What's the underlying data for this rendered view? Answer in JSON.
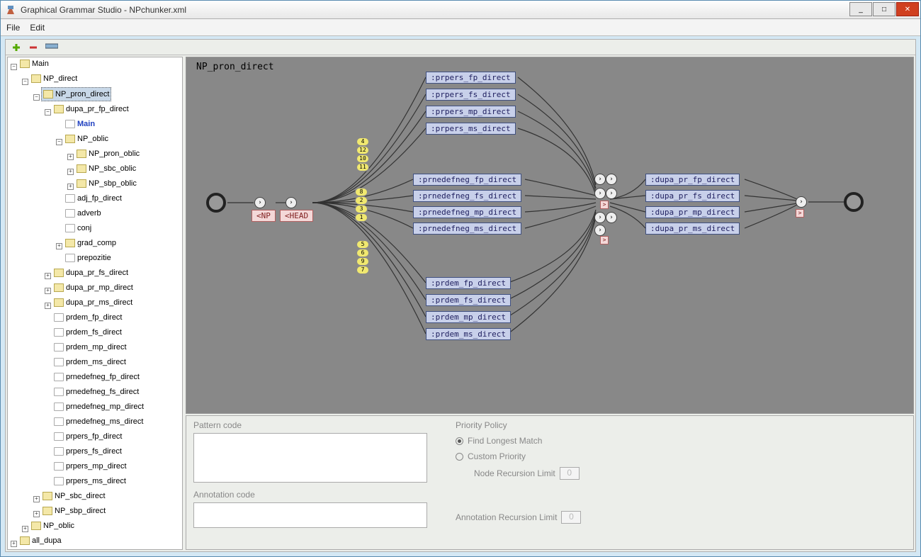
{
  "window": {
    "title": "Graphical Grammar Studio - NPchunker.xml"
  },
  "menubar": {
    "file": "File",
    "edit": "Edit"
  },
  "canvas": {
    "title": "NP_pron_direct"
  },
  "tree": {
    "main": "Main",
    "np_direct": "NP_direct",
    "np_pron_direct": "NP_pron_direct",
    "dupa_pr_fp_direct": "dupa_pr_fp_direct",
    "main_sub": "Main",
    "np_oblic": "NP_oblic",
    "np_pron_oblic": "NP_pron_oblic",
    "np_sbc_oblic": "NP_sbc_oblic",
    "np_sbp_oblic": "NP_sbp_oblic",
    "adj_fp_direct": "adj_fp_direct",
    "adverb": "adverb",
    "conj": "conj",
    "grad_comp": "grad_comp",
    "prepozitie": "prepozitie",
    "dupa_pr_fs_direct": "dupa_pr_fs_direct",
    "dupa_pr_mp_direct": "dupa_pr_mp_direct",
    "dupa_pr_ms_direct": "dupa_pr_ms_direct",
    "prdem_fp_direct": "prdem_fp_direct",
    "prdem_fs_direct": "prdem_fs_direct",
    "prdem_mp_direct": "prdem_mp_direct",
    "prdem_ms_direct": "prdem_ms_direct",
    "prnedefneg_fp_direct": "prnedefneg_fp_direct",
    "prnedefneg_fs_direct": "prnedefneg_fs_direct",
    "prnedefneg_mp_direct": "prnedefneg_mp_direct",
    "prnedefneg_ms_direct": "prnedefneg_ms_direct",
    "prpers_fp_direct": "prpers_fp_direct",
    "prpers_fs_direct": "prpers_fs_direct",
    "prpers_mp_direct": "prpers_mp_direct",
    "prpers_ms_direct": "prpers_ms_direct",
    "np_sbc_direct": "NP_sbc_direct",
    "np_sbp_direct": "NP_sbp_direct",
    "np_oblic2": "NP_oblic",
    "all_dupa": "all_dupa"
  },
  "nodes": {
    "np": "<NP",
    "head": "<HEAD",
    "group1": {
      "a": ":prpers_fp_direct",
      "b": ":prpers_fs_direct",
      "c": ":prpers_mp_direct",
      "d": ":prpers_ms_direct"
    },
    "group2": {
      "a": ":prnedefneg_fp_direct",
      "b": ":prnedefneg_fs_direct",
      "c": ":prnedefneg_mp_direct",
      "d": ":prnedefneg_ms_direct"
    },
    "group3": {
      "a": ":prdem_fp_direct",
      "b": ":prdem_fs_direct",
      "c": ":prdem_mp_direct",
      "d": ":prdem_ms_direct"
    },
    "group4": {
      "a": ":dupa_pr_fp_direct",
      "b": ":dupa_pr_fs_direct",
      "c": ":dupa_pr_mp_direct",
      "d": ":dupa_pr_ms_direct"
    },
    "gt1": ">",
    "gt2": ">",
    "gt3": ">"
  },
  "pills": {
    "p4": "4",
    "p12": "12",
    "p10": "10",
    "p11": "11",
    "p8": "8",
    "p2": "2",
    "p3": "3",
    "p1": "1",
    "p5": "5",
    "p6": "6",
    "p9": "9",
    "p7": "7"
  },
  "props": {
    "pattern_label": "Pattern code",
    "annotation_label": "Annotation code",
    "priority_label": "Priority Policy",
    "find_longest": "Find Longest Match",
    "custom_priority": "Custom Priority",
    "node_recursion": "Node Recursion Limit",
    "annotation_recursion": "Annotation Recursion Limit",
    "recursion_value": "0"
  }
}
